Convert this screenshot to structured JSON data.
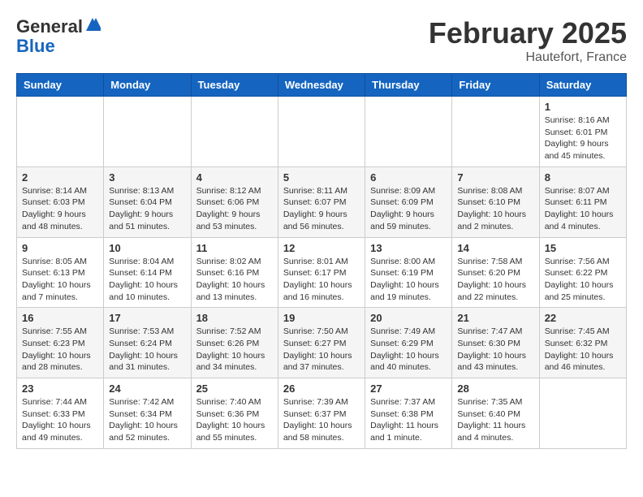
{
  "header": {
    "logo_general": "General",
    "logo_blue": "Blue",
    "month_title": "February 2025",
    "location": "Hautefort, France"
  },
  "days_of_week": [
    "Sunday",
    "Monday",
    "Tuesday",
    "Wednesday",
    "Thursday",
    "Friday",
    "Saturday"
  ],
  "weeks": [
    [
      {
        "day": "",
        "info": ""
      },
      {
        "day": "",
        "info": ""
      },
      {
        "day": "",
        "info": ""
      },
      {
        "day": "",
        "info": ""
      },
      {
        "day": "",
        "info": ""
      },
      {
        "day": "",
        "info": ""
      },
      {
        "day": "1",
        "info": "Sunrise: 8:16 AM\nSunset: 6:01 PM\nDaylight: 9 hours and 45 minutes."
      }
    ],
    [
      {
        "day": "2",
        "info": "Sunrise: 8:14 AM\nSunset: 6:03 PM\nDaylight: 9 hours and 48 minutes."
      },
      {
        "day": "3",
        "info": "Sunrise: 8:13 AM\nSunset: 6:04 PM\nDaylight: 9 hours and 51 minutes."
      },
      {
        "day": "4",
        "info": "Sunrise: 8:12 AM\nSunset: 6:06 PM\nDaylight: 9 hours and 53 minutes."
      },
      {
        "day": "5",
        "info": "Sunrise: 8:11 AM\nSunset: 6:07 PM\nDaylight: 9 hours and 56 minutes."
      },
      {
        "day": "6",
        "info": "Sunrise: 8:09 AM\nSunset: 6:09 PM\nDaylight: 9 hours and 59 minutes."
      },
      {
        "day": "7",
        "info": "Sunrise: 8:08 AM\nSunset: 6:10 PM\nDaylight: 10 hours and 2 minutes."
      },
      {
        "day": "8",
        "info": "Sunrise: 8:07 AM\nSunset: 6:11 PM\nDaylight: 10 hours and 4 minutes."
      }
    ],
    [
      {
        "day": "9",
        "info": "Sunrise: 8:05 AM\nSunset: 6:13 PM\nDaylight: 10 hours and 7 minutes."
      },
      {
        "day": "10",
        "info": "Sunrise: 8:04 AM\nSunset: 6:14 PM\nDaylight: 10 hours and 10 minutes."
      },
      {
        "day": "11",
        "info": "Sunrise: 8:02 AM\nSunset: 6:16 PM\nDaylight: 10 hours and 13 minutes."
      },
      {
        "day": "12",
        "info": "Sunrise: 8:01 AM\nSunset: 6:17 PM\nDaylight: 10 hours and 16 minutes."
      },
      {
        "day": "13",
        "info": "Sunrise: 8:00 AM\nSunset: 6:19 PM\nDaylight: 10 hours and 19 minutes."
      },
      {
        "day": "14",
        "info": "Sunrise: 7:58 AM\nSunset: 6:20 PM\nDaylight: 10 hours and 22 minutes."
      },
      {
        "day": "15",
        "info": "Sunrise: 7:56 AM\nSunset: 6:22 PM\nDaylight: 10 hours and 25 minutes."
      }
    ],
    [
      {
        "day": "16",
        "info": "Sunrise: 7:55 AM\nSunset: 6:23 PM\nDaylight: 10 hours and 28 minutes."
      },
      {
        "day": "17",
        "info": "Sunrise: 7:53 AM\nSunset: 6:24 PM\nDaylight: 10 hours and 31 minutes."
      },
      {
        "day": "18",
        "info": "Sunrise: 7:52 AM\nSunset: 6:26 PM\nDaylight: 10 hours and 34 minutes."
      },
      {
        "day": "19",
        "info": "Sunrise: 7:50 AM\nSunset: 6:27 PM\nDaylight: 10 hours and 37 minutes."
      },
      {
        "day": "20",
        "info": "Sunrise: 7:49 AM\nSunset: 6:29 PM\nDaylight: 10 hours and 40 minutes."
      },
      {
        "day": "21",
        "info": "Sunrise: 7:47 AM\nSunset: 6:30 PM\nDaylight: 10 hours and 43 minutes."
      },
      {
        "day": "22",
        "info": "Sunrise: 7:45 AM\nSunset: 6:32 PM\nDaylight: 10 hours and 46 minutes."
      }
    ],
    [
      {
        "day": "23",
        "info": "Sunrise: 7:44 AM\nSunset: 6:33 PM\nDaylight: 10 hours and 49 minutes."
      },
      {
        "day": "24",
        "info": "Sunrise: 7:42 AM\nSunset: 6:34 PM\nDaylight: 10 hours and 52 minutes."
      },
      {
        "day": "25",
        "info": "Sunrise: 7:40 AM\nSunset: 6:36 PM\nDaylight: 10 hours and 55 minutes."
      },
      {
        "day": "26",
        "info": "Sunrise: 7:39 AM\nSunset: 6:37 PM\nDaylight: 10 hours and 58 minutes."
      },
      {
        "day": "27",
        "info": "Sunrise: 7:37 AM\nSunset: 6:38 PM\nDaylight: 11 hours and 1 minute."
      },
      {
        "day": "28",
        "info": "Sunrise: 7:35 AM\nSunset: 6:40 PM\nDaylight: 11 hours and 4 minutes."
      },
      {
        "day": "",
        "info": ""
      }
    ]
  ]
}
